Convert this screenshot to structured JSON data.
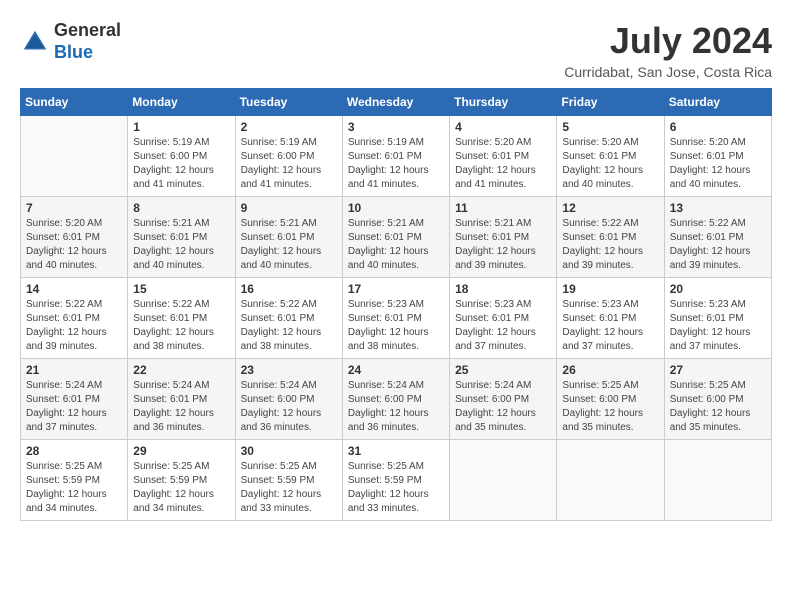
{
  "header": {
    "logo_general": "General",
    "logo_blue": "Blue",
    "title": "July 2024",
    "location": "Curridabat, San Jose, Costa Rica"
  },
  "days_of_week": [
    "Sunday",
    "Monday",
    "Tuesday",
    "Wednesday",
    "Thursday",
    "Friday",
    "Saturday"
  ],
  "weeks": [
    [
      {
        "day": "",
        "info": ""
      },
      {
        "day": "1",
        "info": "Sunrise: 5:19 AM\nSunset: 6:00 PM\nDaylight: 12 hours\nand 41 minutes."
      },
      {
        "day": "2",
        "info": "Sunrise: 5:19 AM\nSunset: 6:00 PM\nDaylight: 12 hours\nand 41 minutes."
      },
      {
        "day": "3",
        "info": "Sunrise: 5:19 AM\nSunset: 6:01 PM\nDaylight: 12 hours\nand 41 minutes."
      },
      {
        "day": "4",
        "info": "Sunrise: 5:20 AM\nSunset: 6:01 PM\nDaylight: 12 hours\nand 41 minutes."
      },
      {
        "day": "5",
        "info": "Sunrise: 5:20 AM\nSunset: 6:01 PM\nDaylight: 12 hours\nand 40 minutes."
      },
      {
        "day": "6",
        "info": "Sunrise: 5:20 AM\nSunset: 6:01 PM\nDaylight: 12 hours\nand 40 minutes."
      }
    ],
    [
      {
        "day": "7",
        "info": "Sunrise: 5:20 AM\nSunset: 6:01 PM\nDaylight: 12 hours\nand 40 minutes."
      },
      {
        "day": "8",
        "info": "Sunrise: 5:21 AM\nSunset: 6:01 PM\nDaylight: 12 hours\nand 40 minutes."
      },
      {
        "day": "9",
        "info": "Sunrise: 5:21 AM\nSunset: 6:01 PM\nDaylight: 12 hours\nand 40 minutes."
      },
      {
        "day": "10",
        "info": "Sunrise: 5:21 AM\nSunset: 6:01 PM\nDaylight: 12 hours\nand 40 minutes."
      },
      {
        "day": "11",
        "info": "Sunrise: 5:21 AM\nSunset: 6:01 PM\nDaylight: 12 hours\nand 39 minutes."
      },
      {
        "day": "12",
        "info": "Sunrise: 5:22 AM\nSunset: 6:01 PM\nDaylight: 12 hours\nand 39 minutes."
      },
      {
        "day": "13",
        "info": "Sunrise: 5:22 AM\nSunset: 6:01 PM\nDaylight: 12 hours\nand 39 minutes."
      }
    ],
    [
      {
        "day": "14",
        "info": "Sunrise: 5:22 AM\nSunset: 6:01 PM\nDaylight: 12 hours\nand 39 minutes."
      },
      {
        "day": "15",
        "info": "Sunrise: 5:22 AM\nSunset: 6:01 PM\nDaylight: 12 hours\nand 38 minutes."
      },
      {
        "day": "16",
        "info": "Sunrise: 5:22 AM\nSunset: 6:01 PM\nDaylight: 12 hours\nand 38 minutes."
      },
      {
        "day": "17",
        "info": "Sunrise: 5:23 AM\nSunset: 6:01 PM\nDaylight: 12 hours\nand 38 minutes."
      },
      {
        "day": "18",
        "info": "Sunrise: 5:23 AM\nSunset: 6:01 PM\nDaylight: 12 hours\nand 37 minutes."
      },
      {
        "day": "19",
        "info": "Sunrise: 5:23 AM\nSunset: 6:01 PM\nDaylight: 12 hours\nand 37 minutes."
      },
      {
        "day": "20",
        "info": "Sunrise: 5:23 AM\nSunset: 6:01 PM\nDaylight: 12 hours\nand 37 minutes."
      }
    ],
    [
      {
        "day": "21",
        "info": "Sunrise: 5:24 AM\nSunset: 6:01 PM\nDaylight: 12 hours\nand 37 minutes."
      },
      {
        "day": "22",
        "info": "Sunrise: 5:24 AM\nSunset: 6:01 PM\nDaylight: 12 hours\nand 36 minutes."
      },
      {
        "day": "23",
        "info": "Sunrise: 5:24 AM\nSunset: 6:00 PM\nDaylight: 12 hours\nand 36 minutes."
      },
      {
        "day": "24",
        "info": "Sunrise: 5:24 AM\nSunset: 6:00 PM\nDaylight: 12 hours\nand 36 minutes."
      },
      {
        "day": "25",
        "info": "Sunrise: 5:24 AM\nSunset: 6:00 PM\nDaylight: 12 hours\nand 35 minutes."
      },
      {
        "day": "26",
        "info": "Sunrise: 5:25 AM\nSunset: 6:00 PM\nDaylight: 12 hours\nand 35 minutes."
      },
      {
        "day": "27",
        "info": "Sunrise: 5:25 AM\nSunset: 6:00 PM\nDaylight: 12 hours\nand 35 minutes."
      }
    ],
    [
      {
        "day": "28",
        "info": "Sunrise: 5:25 AM\nSunset: 5:59 PM\nDaylight: 12 hours\nand 34 minutes."
      },
      {
        "day": "29",
        "info": "Sunrise: 5:25 AM\nSunset: 5:59 PM\nDaylight: 12 hours\nand 34 minutes."
      },
      {
        "day": "30",
        "info": "Sunrise: 5:25 AM\nSunset: 5:59 PM\nDaylight: 12 hours\nand 33 minutes."
      },
      {
        "day": "31",
        "info": "Sunrise: 5:25 AM\nSunset: 5:59 PM\nDaylight: 12 hours\nand 33 minutes."
      },
      {
        "day": "",
        "info": ""
      },
      {
        "day": "",
        "info": ""
      },
      {
        "day": "",
        "info": ""
      }
    ]
  ]
}
